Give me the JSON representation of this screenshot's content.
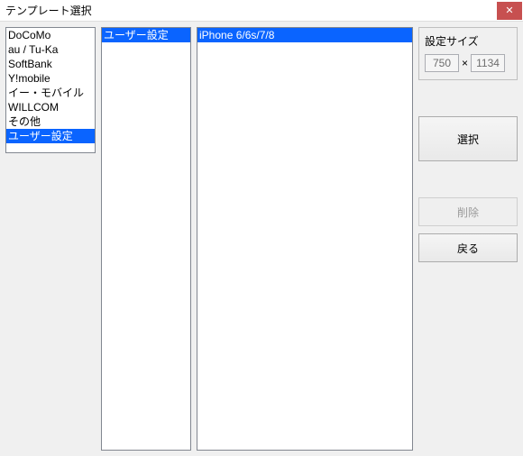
{
  "window": {
    "title": "テンプレート選択",
    "close_glyph": "✕"
  },
  "categories": {
    "items": [
      {
        "label": "DoCoMo",
        "selected": false
      },
      {
        "label": "au / Tu-Ka",
        "selected": false
      },
      {
        "label": "SoftBank",
        "selected": false
      },
      {
        "label": "Y!mobile",
        "selected": false
      },
      {
        "label": "イー・モバイル",
        "selected": false
      },
      {
        "label": "WILLCOM",
        "selected": false
      },
      {
        "label": "その他",
        "selected": false
      },
      {
        "label": "ユーザー設定",
        "selected": true
      }
    ]
  },
  "subcategories": {
    "items": [
      {
        "label": "ユーザー設定",
        "selected": true
      }
    ]
  },
  "templates": {
    "items": [
      {
        "label": "iPhone 6/6s/7/8",
        "selected": true
      }
    ]
  },
  "size_group": {
    "title": "設定サイズ",
    "width": "750",
    "separator": "×",
    "height": "1134"
  },
  "buttons": {
    "select": "選択",
    "delete": "削除",
    "back": "戻る"
  }
}
